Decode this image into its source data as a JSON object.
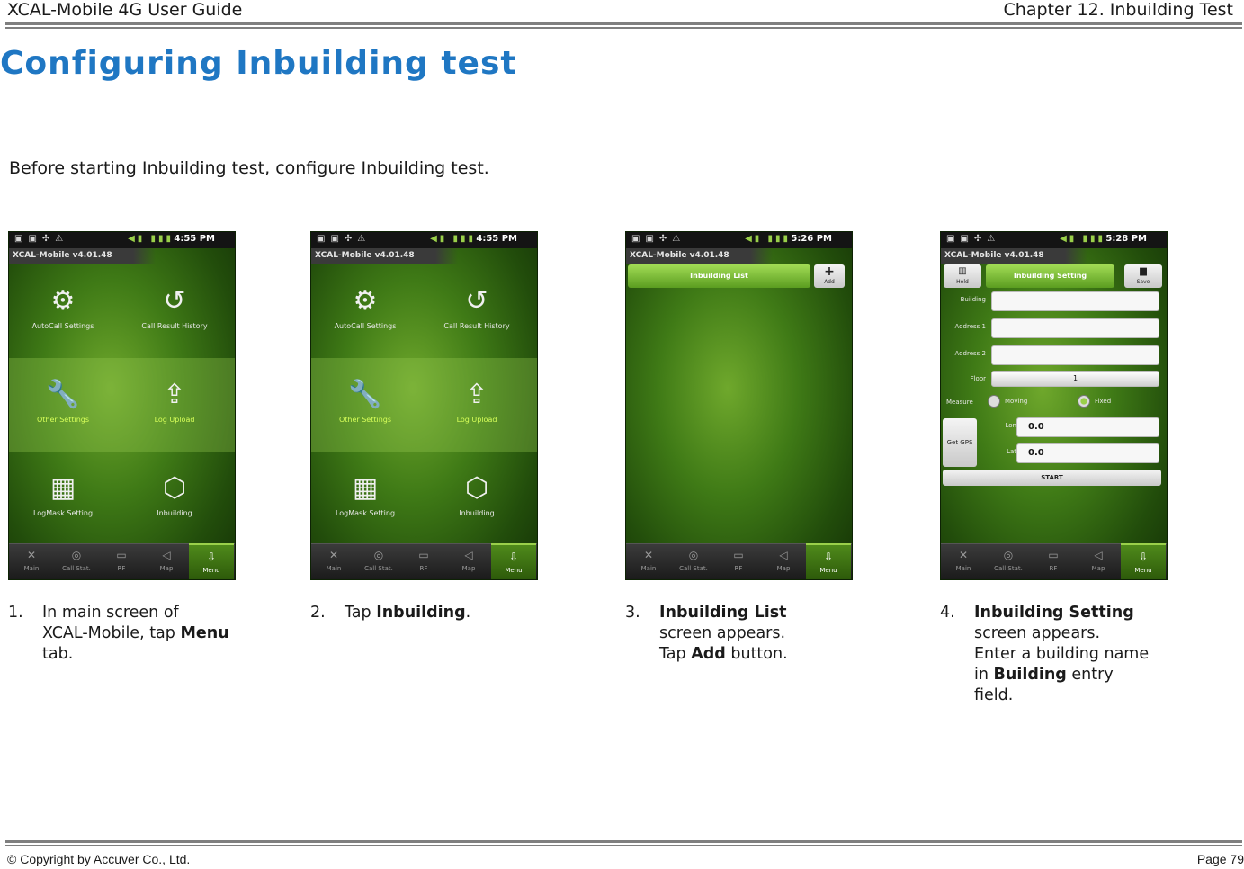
{
  "header": {
    "guide_title": "XCAL-Mobile 4G User Guide",
    "chapter": "Chapter 12. Inbuilding Test"
  },
  "section_title": "Configuring Inbuilding test",
  "intro": "Before starting Inbuilding test, configure Inbuilding test.",
  "phone_common": {
    "app_title": "XCAL-Mobile v4.01.48",
    "tabs": [
      "Main",
      "Call Stat.",
      "RF",
      "Map",
      "Menu"
    ],
    "active_tab": "Menu"
  },
  "screens": [
    {
      "time": "4:55 PM",
      "highlighted_item": "none"
    },
    {
      "time": "4:55 PM",
      "highlighted_item": "Inbuilding"
    },
    {
      "time": "5:26 PM"
    },
    {
      "time": "5:28 PM"
    }
  ],
  "menu_items": {
    "autocall": "AutoCall Settings",
    "call_result": "Call Result History",
    "other": "Other Settings",
    "log_upload": "Log Upload",
    "logmask": "LogMask Setting",
    "inbuilding": "Inbuilding"
  },
  "inbuilding_list": {
    "title": "Inbuilding List",
    "add_label": "Add"
  },
  "inbuilding_setting": {
    "left_button": "Hold",
    "title": "Inbuilding Setting",
    "right_button": "Save",
    "fields": {
      "building_label": "Building",
      "building_value": "",
      "address1_label": "Address 1",
      "address1_value": "",
      "address2_label": "Address 2",
      "address2_value": "",
      "floor_label": "Floor",
      "floor_value": "1",
      "measure_label": "Measure",
      "measure_opt1": "Moving",
      "measure_opt2": "Fixed",
      "lon_label": "Lon",
      "lon_value": "0.0",
      "lat_label": "Lat",
      "lat_value": "0.0"
    },
    "get_gps": "Get GPS",
    "start": "START"
  },
  "steps": {
    "s1": {
      "num": "1.",
      "line1": "In main screen of",
      "line2a": "XCAL-Mobile, tap ",
      "line2b": "Menu",
      "line3": "tab."
    },
    "s2": {
      "num": "2.",
      "pre": "Tap ",
      "bold": "Inbuilding",
      "post": "."
    },
    "s3": {
      "num": "3.",
      "bold1": "Inbuilding List",
      "line2": "screen appears.",
      "line3pre": "Tap ",
      "line3bold": "Add",
      "line3post": " button."
    },
    "s4": {
      "num": "4.",
      "bold1": "Inbuilding Setting",
      "line2": "screen appears.",
      "line3": "Enter a building name",
      "line4pre": "in ",
      "line4bold": "Building",
      "line4post": " entry",
      "line5": "field."
    }
  },
  "footer": {
    "copyright": "© Copyright by Accuver Co., Ltd.",
    "page": "Page 79"
  }
}
